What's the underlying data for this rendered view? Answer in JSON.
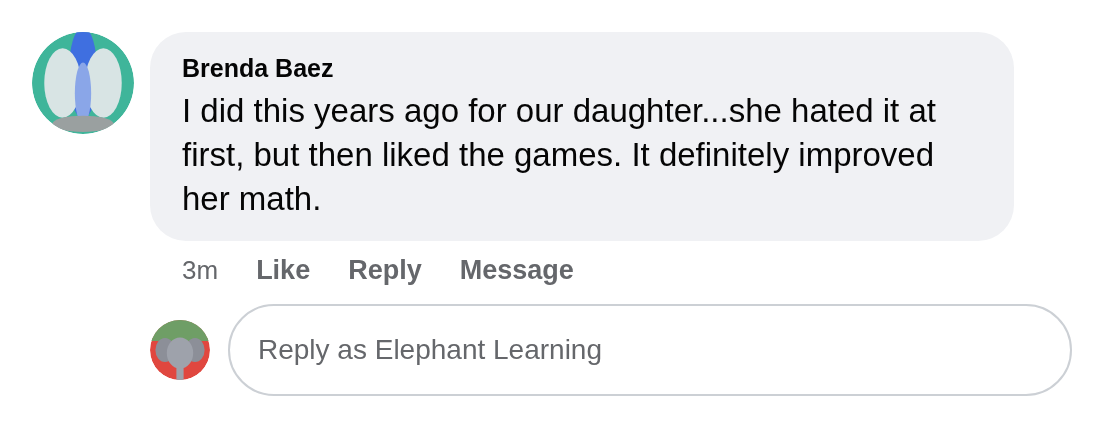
{
  "comment": {
    "author": "Brenda Baez",
    "text": "I did this years ago for our daughter...she hated it at first, but then liked the games. It definitely improved her math."
  },
  "actions": {
    "time": "3m",
    "buttons": [
      "Like",
      "Reply",
      "Message"
    ]
  },
  "reply": {
    "placeholder": "Reply as Elephant Learning"
  }
}
